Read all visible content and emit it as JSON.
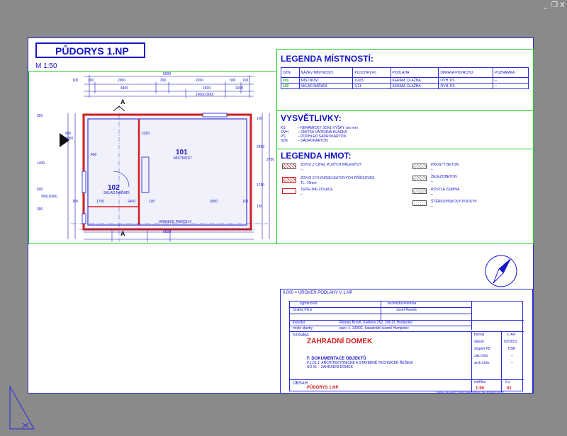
{
  "window": {
    "controls": [
      "_",
      "❐",
      "X"
    ]
  },
  "drawing": {
    "title": "PŮDORYS 1.NP",
    "scale": "M 1:50",
    "dims": {
      "overall": "6900",
      "top_row": [
        "100",
        "300",
        "2900",
        "300",
        "2200",
        "300",
        "100"
      ],
      "second_row": [
        "4400",
        "1500",
        "1000"
      ],
      "window_dim": "1000(1000)",
      "bottom_row": [
        "100",
        "1750",
        "2400",
        "100",
        "3900",
        "100"
      ],
      "bottom_total": "6900",
      "left_col": [
        "950",
        "1400",
        "600",
        "900(1000)",
        "300"
      ],
      "right_col": [
        "100",
        "2450",
        "2700",
        "1750",
        "150"
      ],
      "inner": [
        "2250",
        "450",
        "900",
        "1000",
        "1260"
      ]
    },
    "rooms": [
      {
        "number": "101",
        "name": "MÍSTNOST"
      },
      {
        "number": "102",
        "name": "SKLAD NÁŘADÍ"
      }
    ],
    "section_label": "A",
    "boundary": "HRANICE PARCELY"
  },
  "legend_rooms": {
    "title": "LEGENDA MÍSTNOSTÍ:",
    "headers": [
      "OZN.",
      "NÁZEV MÍSTNOSTI",
      "PLOCHA [m²]",
      "PODLAHA",
      "ÚPRAVA POVRCHU",
      "POZNÁMKA"
    ],
    "rows": [
      [
        "101",
        "MÍSTNOST",
        "19,65",
        "KERAM. DLAŽBA",
        "OVH, PS",
        "–"
      ],
      [
        "102",
        "SKLAD NÁŘADÍ",
        "3,21",
        "KERAM. DLAŽBA",
        "OVH, PS",
        "–"
      ]
    ]
  },
  "explanations": {
    "title": "VYSVĚTLIVKY:",
    "items": [
      [
        "KS",
        "– KERAMICKÝ SOKL VÝŠKY xxx mm"
      ],
      [
        "OVH",
        "– OMÍTKA VÁPENNÁ HLADKÁ"
      ],
      [
        "PS",
        "– PODHLED SÁDROKARTON"
      ],
      [
        "SDK",
        "– SÁDROKARTON"
      ]
    ]
  },
  "legend_materials": {
    "title": "LEGENDA HMOT:",
    "left": [
      {
        "label": "ZDIVO Z CIHEL PLNÝCH PÁLENÝCH",
        "sub": "–"
      },
      {
        "label": "ZDIVO Z PLYNOSILIKÁTOVÝCH PŘÍČKOVEK",
        "sub": "TL. 75mm"
      },
      {
        "label": "TEPELNÁ IZOLACE",
        "sub": "–"
      }
    ],
    "right": [
      {
        "label": "PROSTÝ BETON",
        "sub": "–"
      },
      {
        "label": "ŽELEZOBETON",
        "sub": "–"
      },
      {
        "label": "ROSTLÁ ZEMINA",
        "sub": "–"
      },
      {
        "label": "ŠTĚRKOPÍSKOVÝ PODSYP",
        "sub": "–"
      }
    ]
  },
  "titleblock": {
    "level_note": "0,000 = ÚROVEŇ PODLAHY V 1.NP",
    "vypracoval_label": "vypracoval",
    "vypracoval": "Ondřej Pilný",
    "kontrola_label": "technická kontrola",
    "kontrola": "Josef Resteš",
    "investor_label": "investor",
    "investor": "Roman Brzoň, Květnov 252, 396 01 Humpolec",
    "misto_label": "místo stavby",
    "misto": "parc. č. 1426/1, katastrální území Humpolec",
    "stavba_label": "STAVBA",
    "stavba": "ZAHRADNÍ DOMEK",
    "doc_title": "F. DOKUMENTACE OBJEKTŮ",
    "doc_sub1": "F.1.01.1. ARCHITEKTONICKÉ A STAVEBNĚ TECHNICKÉ ŘEŠENÍ",
    "doc_sub2": "SO 01 – ZAHRADNÍ DOMEK",
    "obsah_label": "OBSAH",
    "obsah": "PŮDORYS 1.NP",
    "format_label": "formát",
    "format": "2. A4",
    "datum_label": "datum",
    "datum": "02/2013",
    "stupen_label": "stupeň PD",
    "stupen": "DSP",
    "zak_label": "zak.číslo",
    "zak": "–",
    "arch_label": "arch.číslo",
    "arch": "–",
    "meritko_label": "měřítko",
    "meritko": "1:50",
    "cv_label": "č.v.",
    "cv": "01",
    "footer": "Uloženo: 19.11.2017 7:04:49 / Vlastník: Brzoň / Tisk: 28.3.2017 9:06:37"
  }
}
